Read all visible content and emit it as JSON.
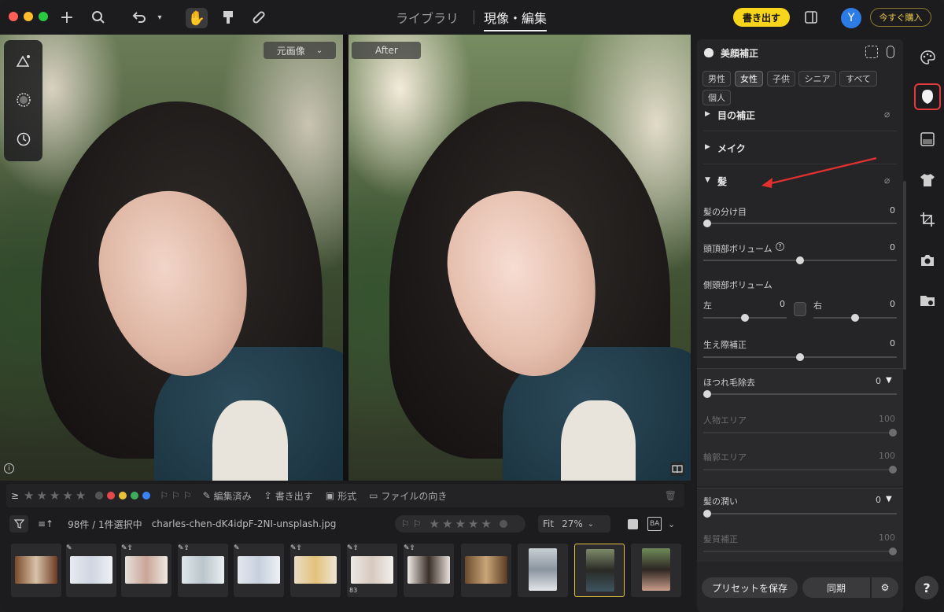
{
  "toolbar": {
    "tabs": [
      {
        "label": "ライブラリ"
      },
      {
        "label": "現像・編集"
      }
    ],
    "export_label": "書き出す",
    "avatar_letter": "Y",
    "buy_label": "今すぐ購入"
  },
  "viewer": {
    "before_label": "元画像",
    "after_label": "After"
  },
  "filmstrip": {
    "filter_row": {
      "edited": "編集済み",
      "exported": "書き出す",
      "format": "形式",
      "orientation": "ファイルの向き"
    },
    "count_text": "98件 / 1件選択中",
    "filename": "charles-chen-dK4idpF-2NI-unsplash.jpg",
    "fit_label": "Fit",
    "zoom": "27%",
    "ba_label": "BA",
    "badge_83": "83"
  },
  "panel": {
    "title": "美顔補正",
    "genders": [
      {
        "label": "男性"
      },
      {
        "label": "女性"
      },
      {
        "label": "子供"
      },
      {
        "label": "シニア"
      },
      {
        "label": "すべて"
      },
      {
        "label": "個人"
      }
    ],
    "eye_section": "目の補正",
    "makeup_section": "メイク",
    "hair_section": "髪",
    "hair_parting": {
      "label": "髪の分け目",
      "value": "0"
    },
    "crown_volume": {
      "label": "頭頂部ボリューム",
      "value": "0"
    },
    "side_volume": {
      "label": "側頭部ボリューム",
      "left_label": "左",
      "left_value": "0",
      "right_label": "右",
      "right_value": "0"
    },
    "hairline": {
      "label": "生え際補正",
      "value": "0"
    },
    "flyaway": {
      "label": "ほつれ毛除去",
      "value": "0"
    },
    "person_area": {
      "label": "人物エリア",
      "value": "100"
    },
    "edge_area": {
      "label": "輪郭エリア",
      "value": "100"
    },
    "hair_gloss": {
      "label": "髪の潤い",
      "value": "0"
    },
    "hair_quality": {
      "label": "髪質補正",
      "value": "100"
    },
    "save_preset": "プリセットを保存",
    "sync": "同期"
  },
  "help_label": "?",
  "colors": {
    "accent_yellow": "#f7d51d",
    "avatar_blue": "#2d7be5",
    "highlight_red": "#e23b3b",
    "arrow_red": "#e03030",
    "label_red": "#e5484d",
    "label_yellow": "#e8c33a",
    "label_green": "#3fae5a",
    "label_blue": "#3b82f6"
  },
  "icons": [
    "plus-icon",
    "search-icon",
    "undo-icon",
    "hand-icon",
    "brush-icon",
    "bandage-icon",
    "panel-icon",
    "triangle-icon",
    "circle-icon",
    "history-icon",
    "palette-icon",
    "face-icon",
    "gradient-icon",
    "tshirt-icon",
    "crop-icon",
    "camera-icon",
    "folder-icon"
  ]
}
